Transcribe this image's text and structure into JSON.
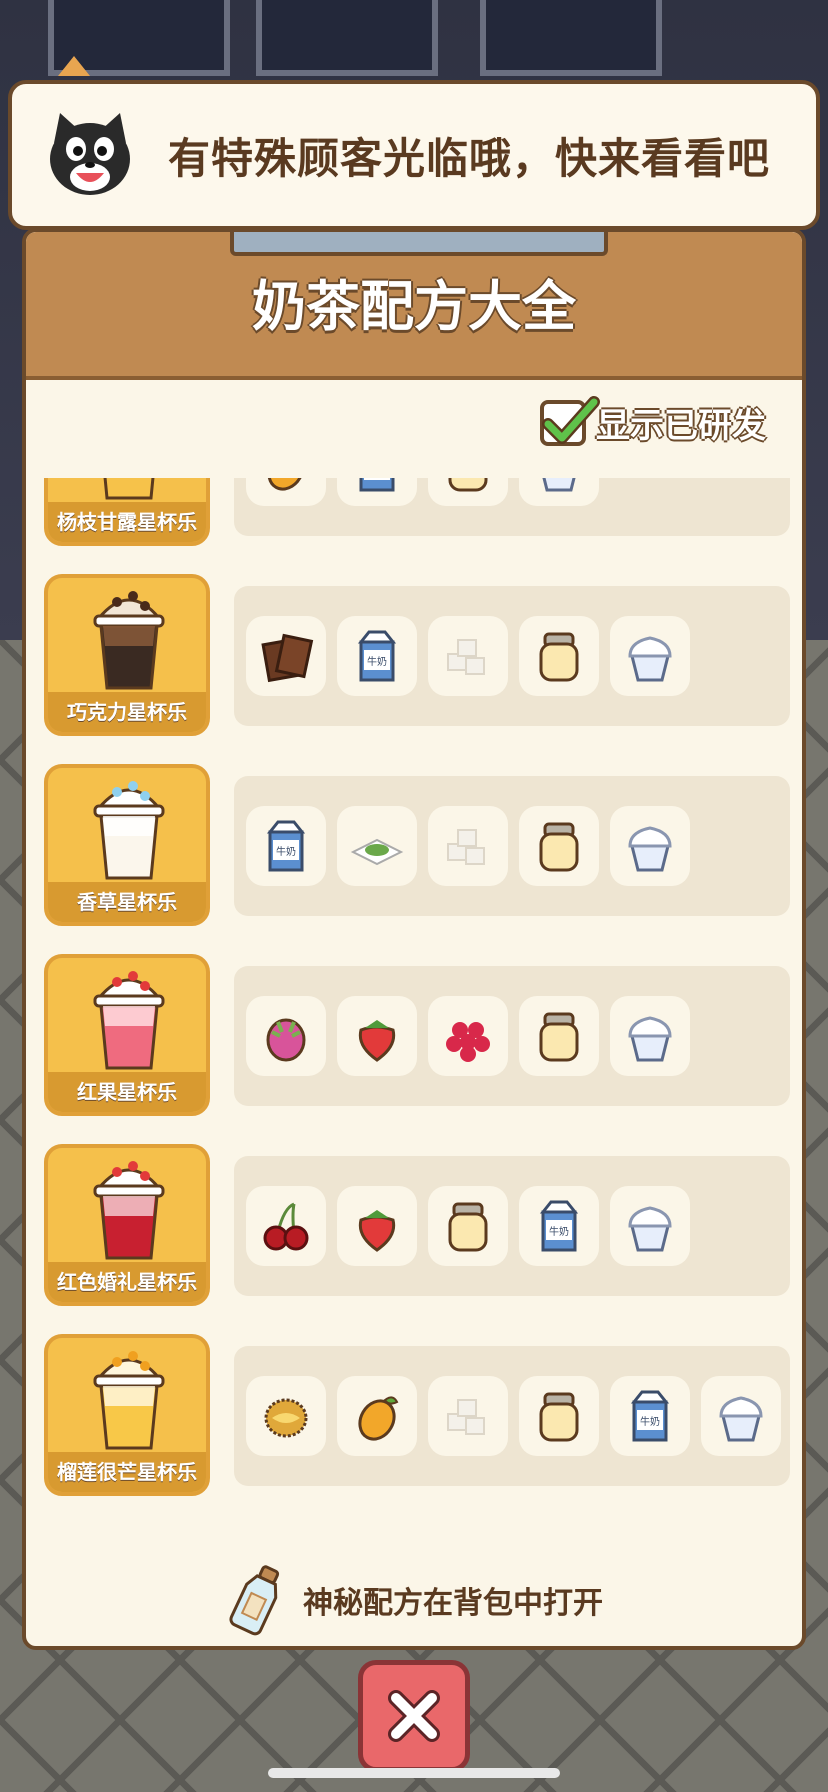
{
  "notification": {
    "text": "有特殊顾客光临哦，快来看看吧",
    "icon": "cat-face-icon"
  },
  "panel": {
    "title": "奶茶配方大全",
    "toggle_label": "显示已研发",
    "toggle_checked": true,
    "footer_text": "神秘配方在背包中打开",
    "footer_icon": "message-bottle-icon"
  },
  "recipes": [
    {
      "name": "杨枝甘露星杯乐",
      "drink_icon": "mango-pomelo-sago-drink-icon",
      "ingredients": [
        "mango",
        "milk",
        "condensed-milk-jar",
        "ice-cream"
      ]
    },
    {
      "name": "巧克力星杯乐",
      "drink_icon": "chocolate-drink-icon",
      "ingredients": [
        "chocolate",
        "milk",
        "sugar-cubes",
        "condensed-milk-jar",
        "ice-cream"
      ]
    },
    {
      "name": "香草星杯乐",
      "drink_icon": "vanilla-drink-icon",
      "ingredients": [
        "milk",
        "matcha-powder",
        "sugar-cubes",
        "condensed-milk-jar",
        "ice-cream"
      ]
    },
    {
      "name": "红果星杯乐",
      "drink_icon": "red-fruit-drink-icon",
      "ingredients": [
        "dragon-fruit",
        "strawberry",
        "raspberry",
        "condensed-milk-jar",
        "ice-cream"
      ]
    },
    {
      "name": "红色婚礼星杯乐",
      "drink_icon": "red-wedding-drink-icon",
      "ingredients": [
        "cherry",
        "strawberry",
        "condensed-milk-jar",
        "milk",
        "ice-cream"
      ]
    },
    {
      "name": "榴莲很芒星杯乐",
      "drink_icon": "durian-mango-drink-icon",
      "ingredients": [
        "durian",
        "mango",
        "sugar-cubes",
        "condensed-milk-jar",
        "milk",
        "ice-cream"
      ]
    }
  ],
  "milk_label": "牛奶",
  "close_icon": "close-x-icon"
}
